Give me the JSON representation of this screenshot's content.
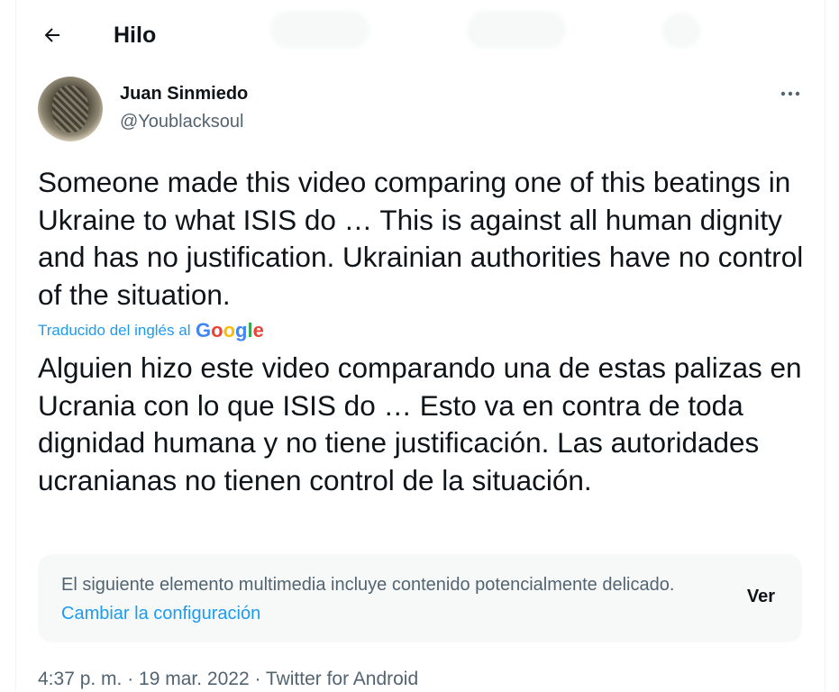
{
  "header": {
    "title": "Hilo"
  },
  "author": {
    "name": "Juan Sinmiedo",
    "handle": "@Youblacksoul"
  },
  "tweet": {
    "text": "Someone made this video comparing one of this beatings in Ukraine to what ISIS do … This is against all human dignity and has no justification. Ukrainian authorities have no control of the situation.",
    "translated_label": "Traducido del inglés al",
    "translation_provider": "Google",
    "translation": "Alguien hizo este video comparando una de estas palizas en Ucrania con lo que ISIS do … Esto va en contra de toda dignidad humana y no tiene justificación. Las autoridades ucranianas no tienen control de la situación."
  },
  "media_warning": {
    "text": "El siguiente elemento multimedia incluye contenido potencialmente delicado.",
    "link": "Cambiar la configuración",
    "view_label": "Ver"
  },
  "meta": {
    "timestamp": "4:37 p. m. · 19 mar. 2022 · Twitter for Android"
  },
  "icons": {
    "back": "arrow-left-icon",
    "more": "more-horizontal-icon"
  },
  "colors": {
    "accent": "#1d9bf0",
    "secondary_text": "#536471",
    "primary_text": "#0f1419",
    "box_background": "#f7f9f9"
  }
}
